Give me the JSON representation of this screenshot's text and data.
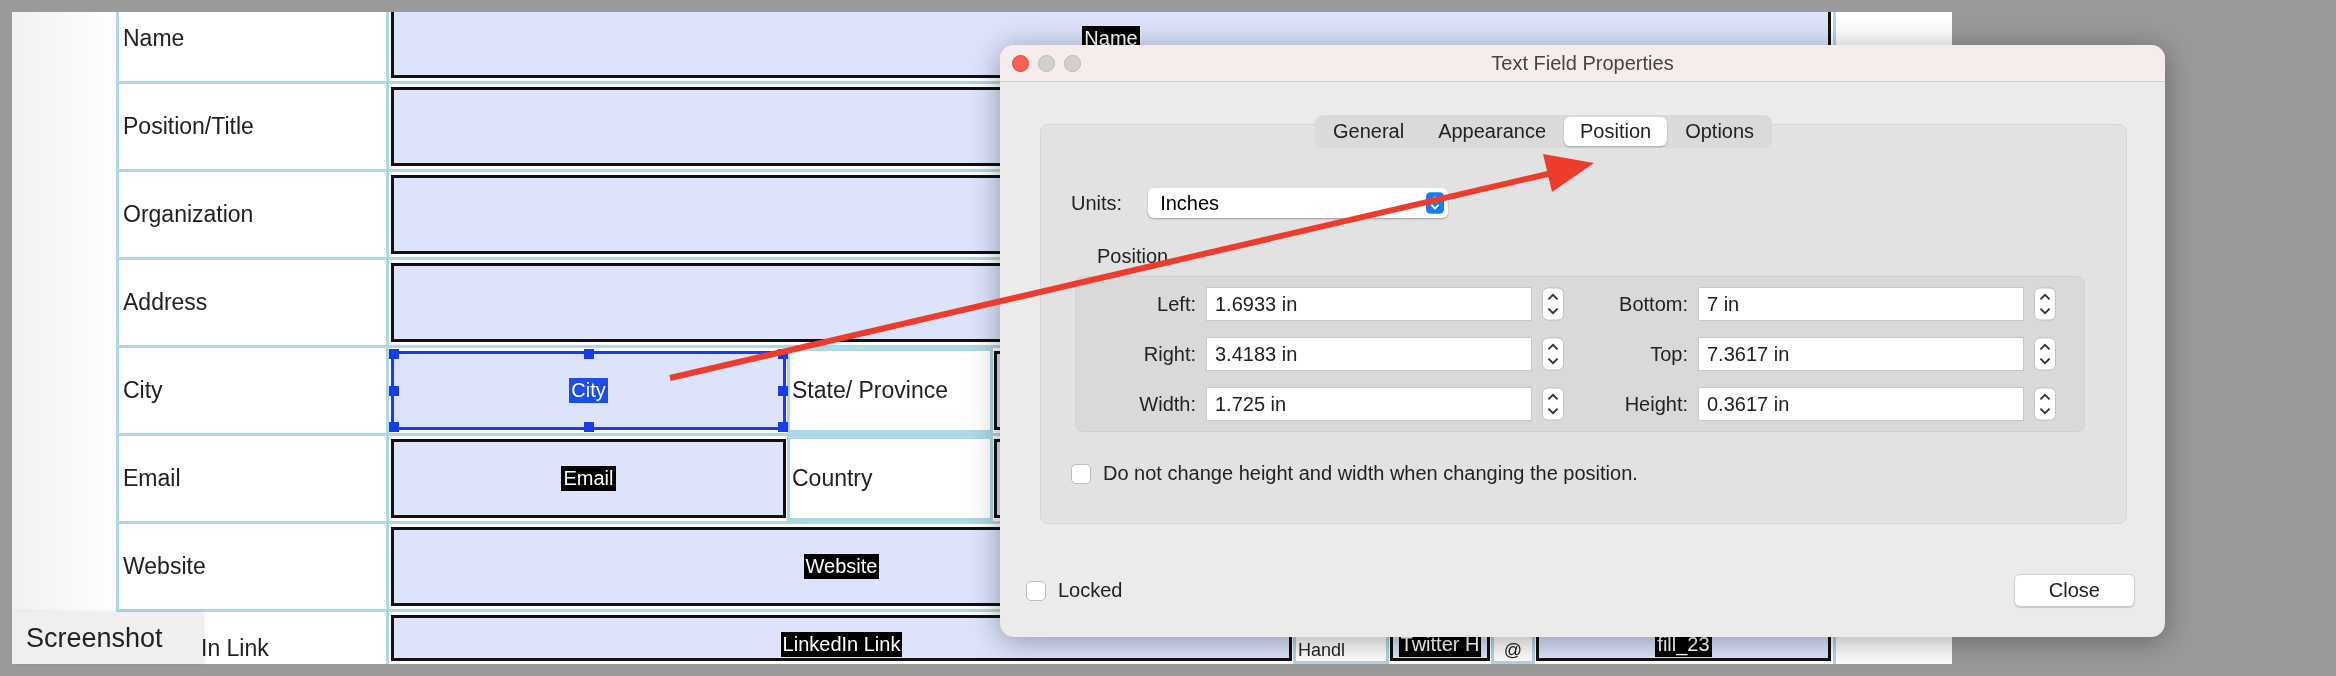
{
  "form": {
    "rows": [
      {
        "label": "Name",
        "kind": "full",
        "cells": [
          {
            "kind": "field",
            "tag": "Name",
            "selected": false
          }
        ]
      },
      {
        "label": "Position/Title",
        "kind": "full",
        "cells": [
          {
            "kind": "field",
            "selected": false
          }
        ]
      },
      {
        "label": "Organization",
        "kind": "full",
        "cells": [
          {
            "kind": "field",
            "selected": false
          }
        ]
      },
      {
        "label": "Address",
        "kind": "full",
        "cells": [
          {
            "kind": "field",
            "selected": false
          }
        ]
      },
      {
        "label": "City",
        "kind": "pair",
        "cells": [
          {
            "kind": "field",
            "tag": "City",
            "selected": true
          },
          {
            "kind": "label",
            "text": "State/ Province"
          },
          {
            "kind": "field",
            "selected": false
          }
        ]
      },
      {
        "label": "Email",
        "kind": "pair",
        "cells": [
          {
            "kind": "field",
            "tag": "Email",
            "selected": false
          },
          {
            "kind": "label",
            "text": "Country"
          },
          {
            "kind": "field",
            "selected": false
          }
        ]
      },
      {
        "label": "Website",
        "kind": "wide",
        "cells": [
          {
            "kind": "field",
            "tag": "Website",
            "selected": false
          }
        ]
      },
      {
        "label": "In Link",
        "kind": "social",
        "cells": [
          {
            "kind": "field",
            "tag": "LinkedIn Link",
            "selected": false
          },
          {
            "kind": "label",
            "text": "Handl"
          },
          {
            "kind": "field",
            "tag": "Twitter H",
            "selected": false
          },
          {
            "kind": "label",
            "text": "@"
          },
          {
            "kind": "field",
            "tag": "fill_23",
            "selected": false
          }
        ]
      }
    ]
  },
  "dialog": {
    "title": "Text Field Properties",
    "tabs": [
      {
        "label": "General",
        "selected": false
      },
      {
        "label": "Appearance",
        "selected": false
      },
      {
        "label": "Position",
        "selected": true
      },
      {
        "label": "Options",
        "selected": false
      }
    ],
    "units": {
      "label": "Units:",
      "value": "Inches"
    },
    "group_label": "Position",
    "fields": [
      {
        "label": "Left:",
        "value": "1.6933 in"
      },
      {
        "label": "Bottom:",
        "value": "7 in"
      },
      {
        "label": "Right:",
        "value": "3.4183 in"
      },
      {
        "label": "Top:",
        "value": "7.3617 in"
      },
      {
        "label": "Width:",
        "value": "1.725 in"
      },
      {
        "label": "Height:",
        "value": "0.3617 in"
      }
    ],
    "keep_size": {
      "label": "Do not change height and width when changing the position.",
      "checked": false
    },
    "locked": {
      "label": "Locked",
      "checked": false
    },
    "close_button": "Close"
  },
  "tooltip": "Screenshot"
}
